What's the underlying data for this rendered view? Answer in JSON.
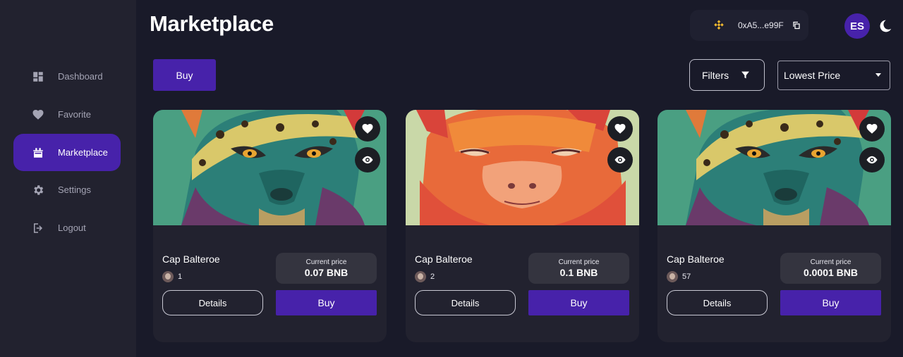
{
  "header": {
    "title": "Marketplace"
  },
  "wallet": {
    "address": "0xA5...e99F",
    "icon": "bnb-icon"
  },
  "user": {
    "initials": "ES"
  },
  "colors": {
    "accent": "#4722aa",
    "background": "#191a29",
    "sidebar": "#22222f",
    "card": "#22222f"
  },
  "sidebar": {
    "items": [
      {
        "label": "Dashboard",
        "icon": "dashboard-icon",
        "active": false
      },
      {
        "label": "Favorite",
        "icon": "heart-icon",
        "active": false
      },
      {
        "label": "Marketplace",
        "icon": "store-icon",
        "active": true
      },
      {
        "label": "Settings",
        "icon": "gear-icon",
        "active": false
      },
      {
        "label": "Logout",
        "icon": "logout-icon",
        "active": false
      }
    ]
  },
  "toolbar": {
    "buy_label": "Buy",
    "filters_label": "Filters",
    "sort_selected": "Lowest Price"
  },
  "cards": [
    {
      "name": "Cap Balteroe",
      "owner_count": "1",
      "price_label": "Current price",
      "price": "0.07 BNB",
      "details_label": "Details",
      "buy_label": "Buy",
      "image": "jaguar"
    },
    {
      "name": "Cap Balteroe",
      "owner_count": "2",
      "price_label": "Current price",
      "price": "0.1 BNB",
      "details_label": "Details",
      "buy_label": "Buy",
      "image": "capybara"
    },
    {
      "name": "Cap Balteroe",
      "owner_count": "57",
      "price_label": "Current price",
      "price": "0.0001 BNB",
      "details_label": "Details",
      "buy_label": "Buy",
      "image": "jaguar"
    }
  ]
}
